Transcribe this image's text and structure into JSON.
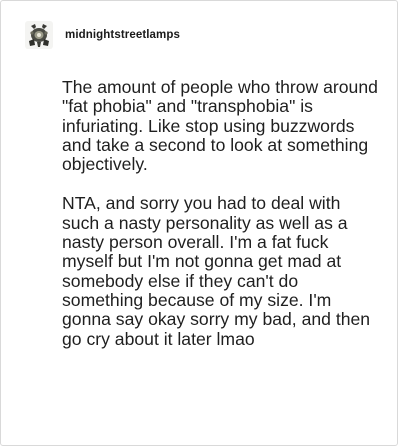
{
  "post": {
    "username": "midnightstreetlamps",
    "avatar_icon": "lamp-avatar-icon",
    "paragraphs": [
      "The amount of people who throw around \"fat phobia\" and \"transphobia\" is infuriating. Like stop using buzzwords and take a second to look at something objectively.",
      "NTA, and sorry you had to deal with such a nasty personality as well as a nasty person overall. I'm a fat fuck myself but I'm not gonna get mad at somebody else if they can't do something because of my size. I'm gonna say okay sorry my bad, and then go cry about it later lmao"
    ]
  }
}
